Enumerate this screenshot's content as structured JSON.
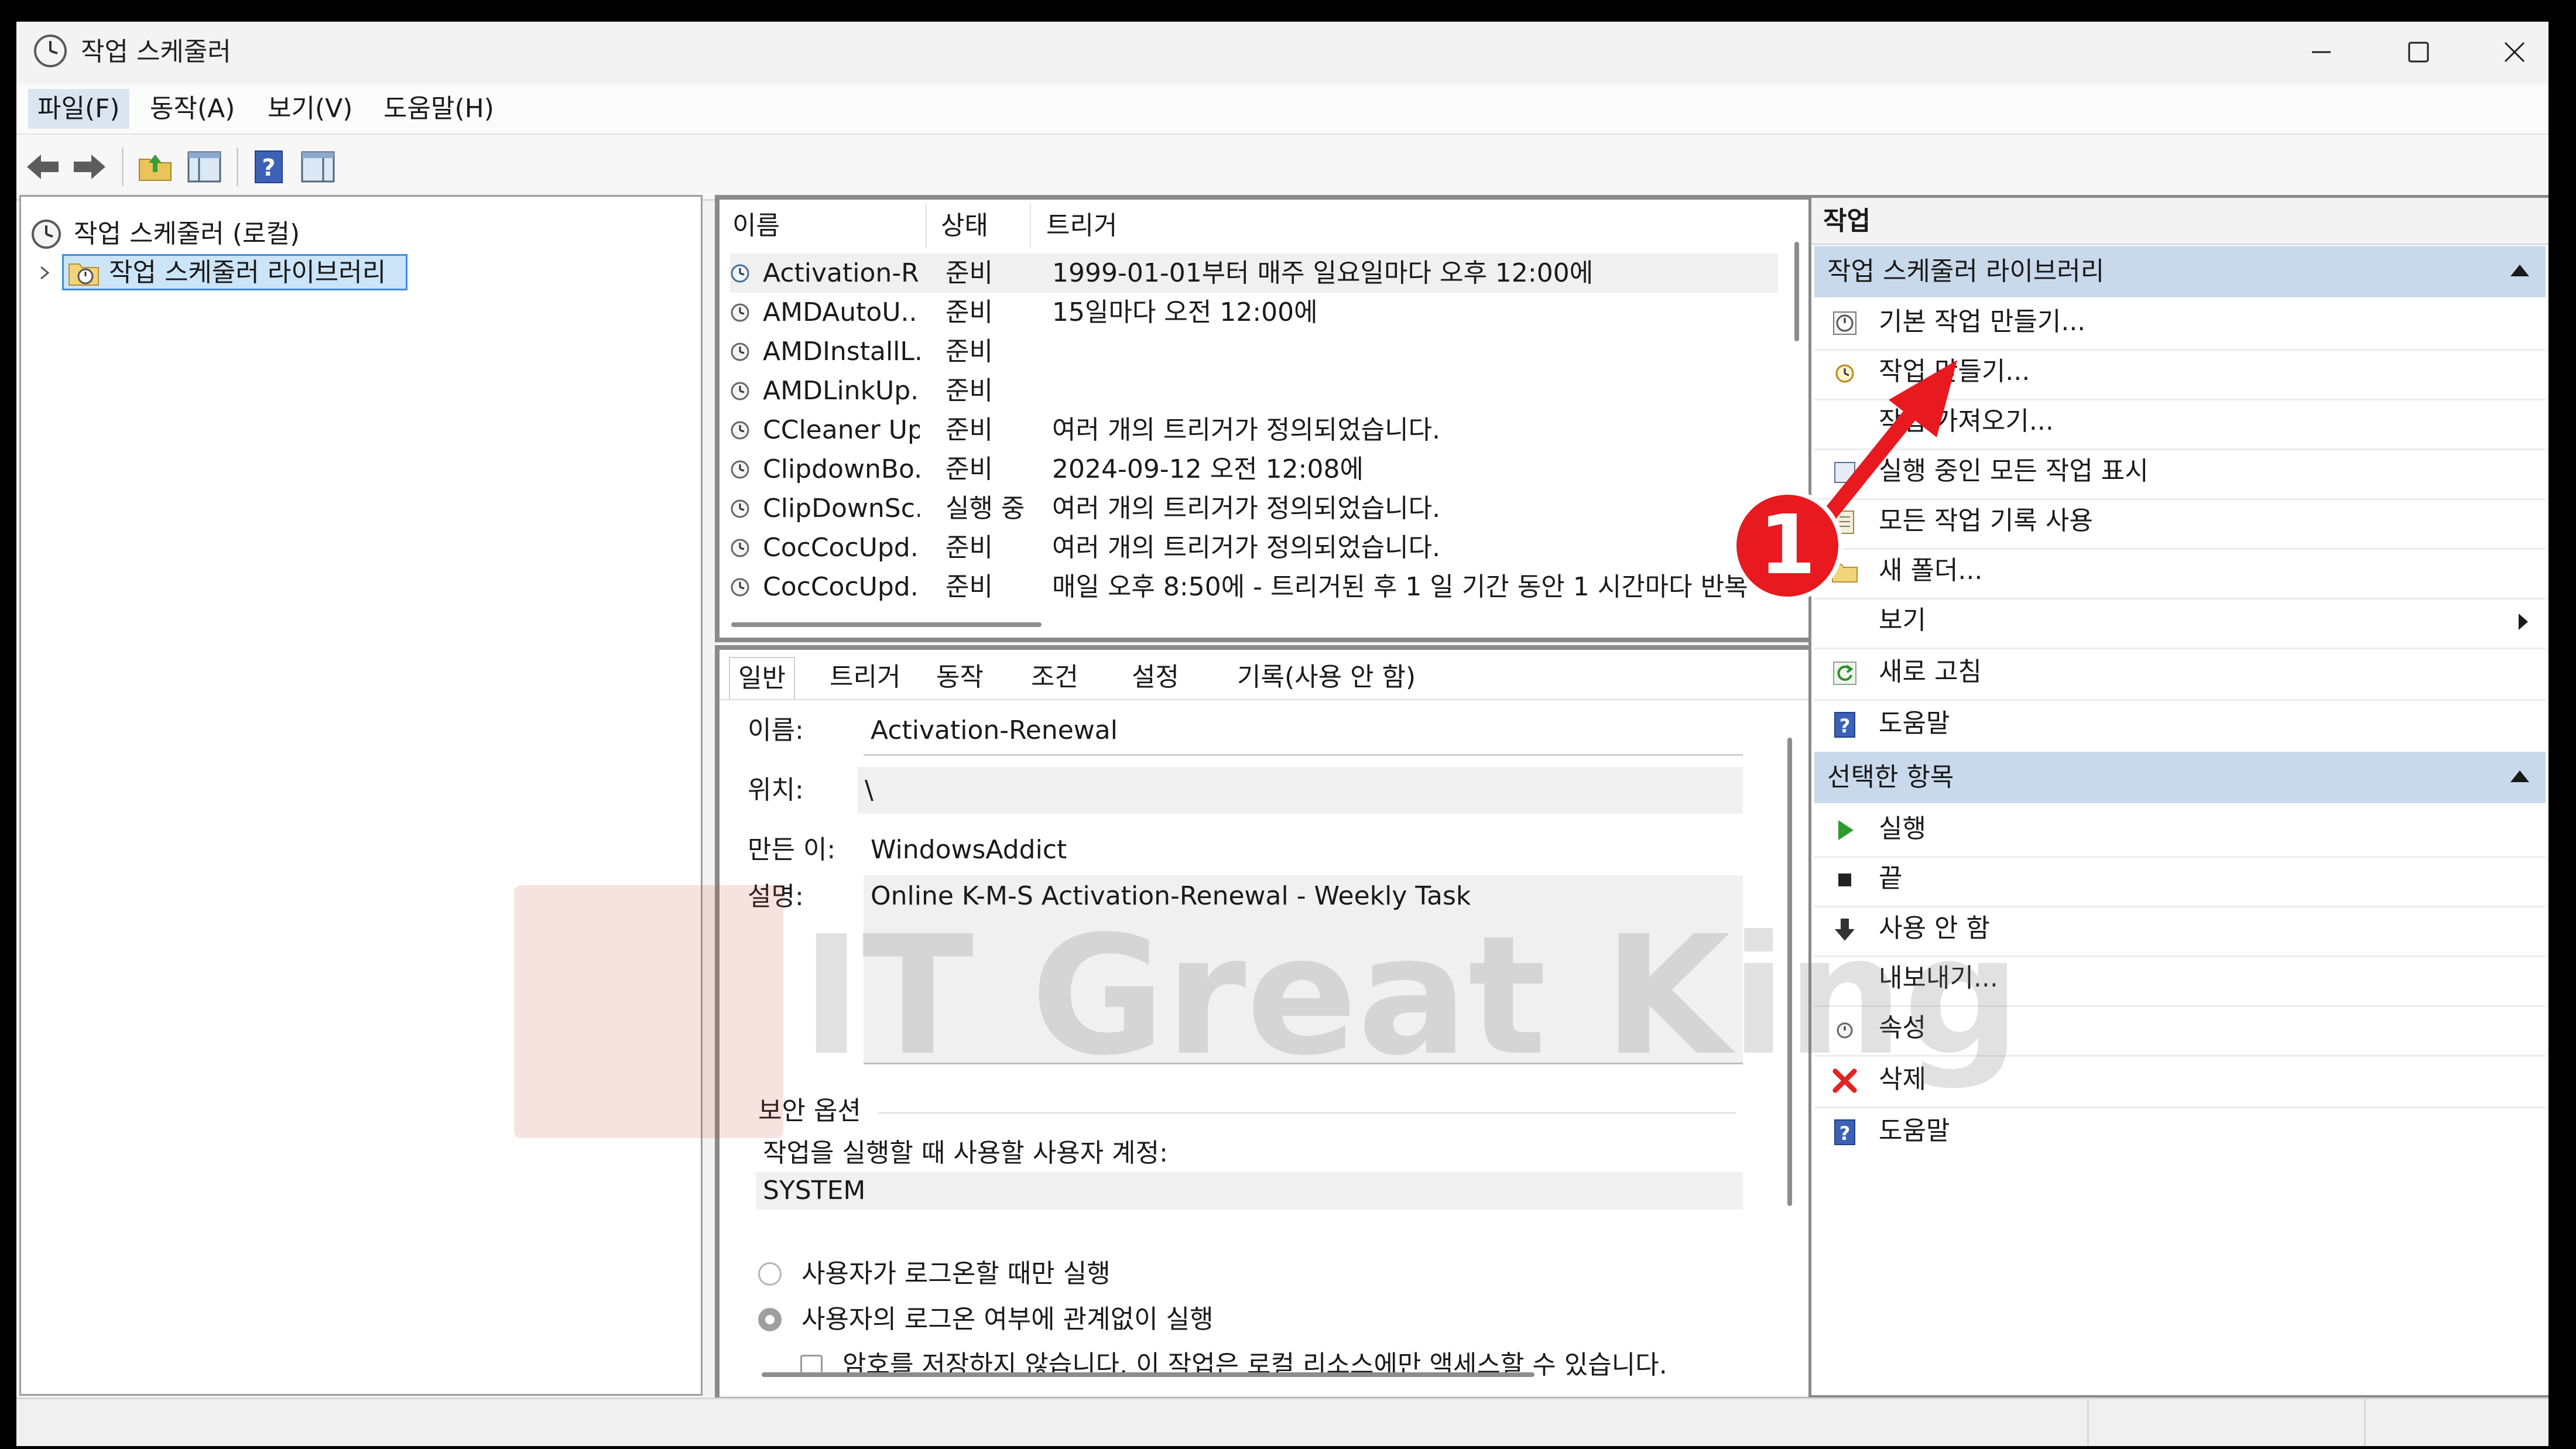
{
  "window": {
    "title": "작업 스케줄러",
    "controls": [
      "minimize",
      "maximize",
      "close"
    ]
  },
  "menubar": [
    "파일(F)",
    "동작(A)",
    "보기(V)",
    "도움말(H)"
  ],
  "toolbar": [
    "back-arrow-icon",
    "forward-arrow-icon",
    "folder-up-icon",
    "show-hide-console-tree-icon",
    "help-icon",
    "show-hide-action-pane-icon"
  ],
  "tree": {
    "root": "작업 스케줄러 (로컬)",
    "library": "작업 스케줄러 라이브러리"
  },
  "task_list": {
    "headers": [
      "이름",
      "상태",
      "트리거"
    ],
    "rows": [
      {
        "name": "Activation-R...",
        "status": "준비",
        "trigger": "1999-01-01부터 매주 일요일마다 오후 12:00에"
      },
      {
        "name": "AMDAutoU...",
        "status": "준비",
        "trigger": "15일마다 오전 12:00에"
      },
      {
        "name": "AMDInstallL...",
        "status": "준비",
        "trigger": ""
      },
      {
        "name": "AMDLinkUp...",
        "status": "준비",
        "trigger": ""
      },
      {
        "name": "CCleaner Up...",
        "status": "준비",
        "trigger": "여러 개의 트리거가 정의되었습니다."
      },
      {
        "name": "ClipdownBo...",
        "status": "준비",
        "trigger": "2024-09-12 오전 12:08에"
      },
      {
        "name": "ClipDownSc...",
        "status": "실행 중",
        "trigger": "여러 개의 트리거가 정의되었습니다."
      },
      {
        "name": "CocCocUpd...",
        "status": "준비",
        "trigger": "여러 개의 트리거가 정의되었습니다."
      },
      {
        "name": "CocCocUpd...",
        "status": "준비",
        "trigger": "매일 오후 8:50에 - 트리거된 후 1 일 기간 동안 1 시간마다 반복"
      }
    ]
  },
  "detail": {
    "tabs": [
      "일반",
      "트리거",
      "동작",
      "조건",
      "설정",
      "기록(사용 안 함)"
    ],
    "name_label": "이름:",
    "name_value": "Activation-Renewal",
    "location_label": "위치:",
    "location_value": "\\",
    "author_label": "만든 이:",
    "author_value": "WindowsAddict",
    "desc_label": "설명:",
    "desc_value": "Online K-M-S Activation-Renewal - Weekly Task",
    "security_header": "보안 옵션",
    "account_label": "작업을 실행할 때 사용할 사용자 계정:",
    "account_value": "SYSTEM",
    "radio1": "사용자가 로그온할 때만 실행",
    "radio2": "사용자의 로그온 여부에 관계없이 실행",
    "checkbox": "암호를 저장하지 않습니다. 이 작업은 로컬 리소스에만 액세스할 수 있습니다."
  },
  "actions": {
    "header": "작업",
    "section1": {
      "title": "작업 스케줄러 라이브러리",
      "items": [
        {
          "icon": "create-basic-task-icon",
          "label": "기본 작업 만들기..."
        },
        {
          "icon": "create-task-icon",
          "label": "작업 만들기..."
        },
        {
          "icon": "import-task-icon",
          "label": "작업 가져오기..."
        },
        {
          "icon": "running-tasks-icon",
          "label": "실행 중인 모든 작업 표시"
        },
        {
          "icon": "history-icon",
          "label": "모든 작업 기록 사용"
        },
        {
          "icon": "new-folder-icon",
          "label": "새 폴더..."
        },
        {
          "icon": "",
          "label": "보기"
        },
        {
          "icon": "refresh-icon",
          "label": "새로 고침"
        },
        {
          "icon": "help-icon",
          "label": "도움말"
        }
      ]
    },
    "section2": {
      "title": "선택한 항목",
      "items": [
        {
          "icon": "run-icon",
          "label": "실행"
        },
        {
          "icon": "stop-icon",
          "label": "끝"
        },
        {
          "icon": "disable-icon",
          "label": "사용 안 함"
        },
        {
          "icon": "",
          "label": "내보내기..."
        },
        {
          "icon": "properties-icon",
          "label": "속성"
        },
        {
          "icon": "delete-icon",
          "label": "삭제"
        },
        {
          "icon": "help-icon",
          "label": "도움말"
        }
      ]
    }
  },
  "annotation": {
    "number": "1",
    "color": "#e8191f"
  },
  "watermark": "IT Great King",
  "colors": {
    "selection": "#cce4f7",
    "section_header": "#c9d9ec",
    "annotation_red": "#e8191f"
  }
}
